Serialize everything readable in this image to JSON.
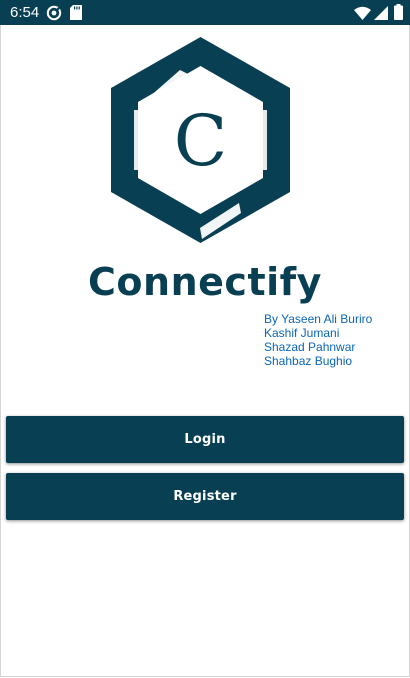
{
  "status_bar": {
    "time": "6:54",
    "left_icons": [
      "sync-badge-icon",
      "sd-card-icon"
    ],
    "right_icons": [
      "wifi-icon",
      "cell-signal-icon",
      "battery-icon"
    ],
    "background": "#083f52"
  },
  "app": {
    "title": "Connectify",
    "logo_letter": "C",
    "brand_color": "#083f52",
    "credits_color": "#0c66b3",
    "credits": [
      "By Yaseen Ali Buriro",
      "Kashif Jumani",
      "Shazad Pahnwar",
      "Shahbaz Bughio"
    ]
  },
  "buttons": {
    "login_label": "Login",
    "register_label": "Register"
  }
}
